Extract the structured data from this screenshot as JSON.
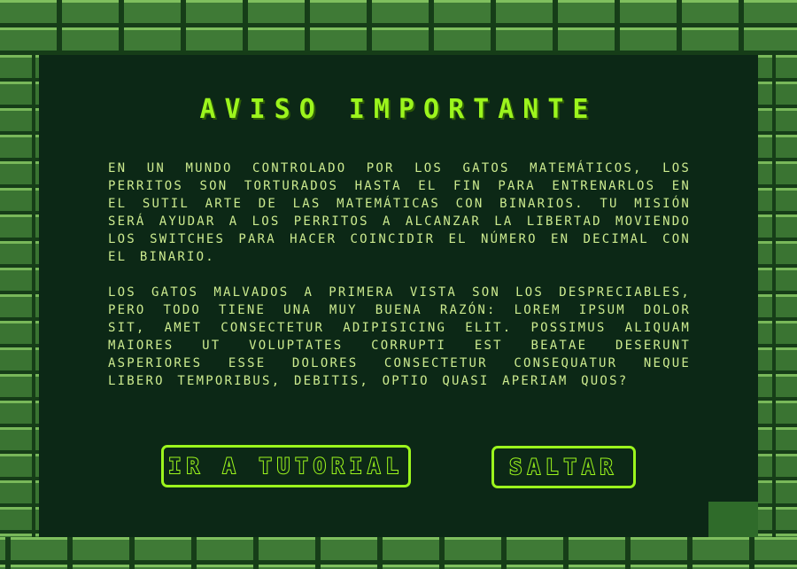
{
  "notice": {
    "title": "AVISO IMPORTANTE",
    "paragraph_1": "En un mundo controlado por los gatos matemáticos, los perritos son torturados hasta el fin para entrenarlos en el sutil arte de las matemáticas con binarios. Tu misión será ayudar a los perritos a alcanzar la libertad moviendo los switches para hacer coincidir el número en decimal con el binario.",
    "paragraph_2": "Los gatos malvados a primera vista son los despreciables, pero todo tiene una muy buena razón: Lorem ipsum dolor sit, amet consectetur adipisicing elit. Possimus aliquam maiores ut voluptates corrupti est beatae deserunt asperiores esse dolores consectetur consequatur neque libero temporibus, debitis, optio quasi aperiam quos?"
  },
  "buttons": {
    "tutorial_label": "IR A TUTORIAL",
    "skip_label": "SALTAR"
  },
  "colors": {
    "accent": "#9cf51d",
    "panel_background": "#0c2816",
    "body_text": "#cdeb8f",
    "brick": "#3f7a36"
  }
}
